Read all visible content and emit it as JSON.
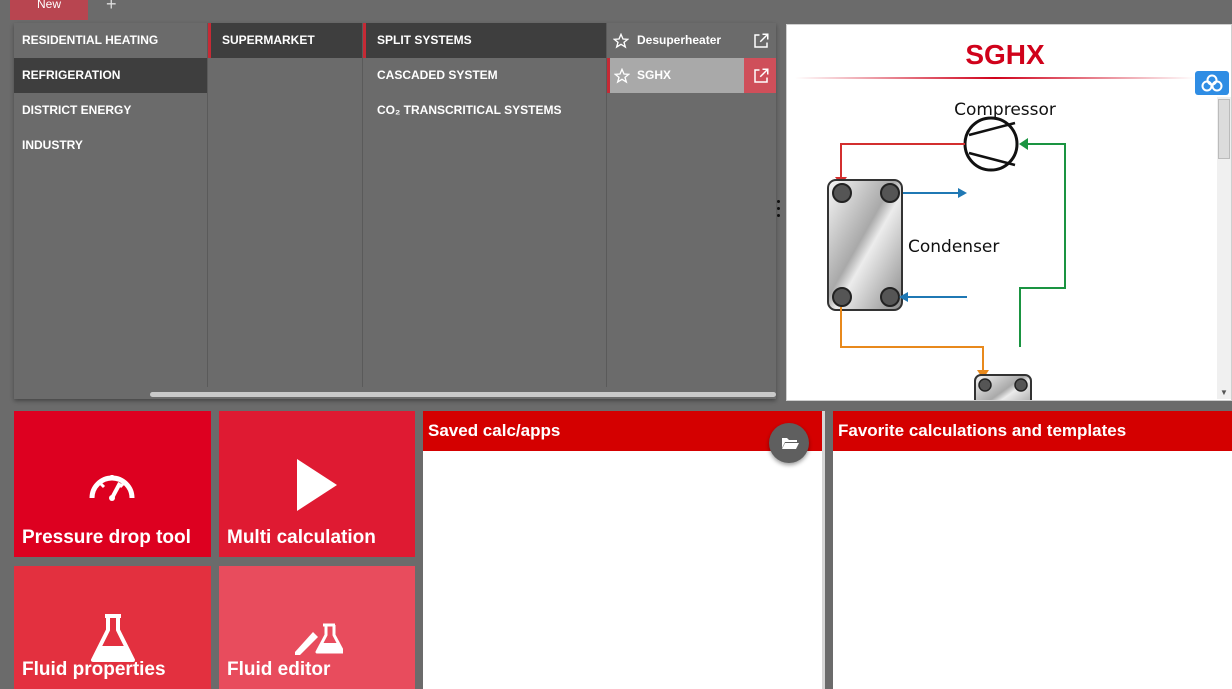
{
  "tabbar": {
    "new_tab_label": "New",
    "add_tab_label": "+"
  },
  "nav": {
    "column1": [
      {
        "label": "RESIDENTIAL HEATING",
        "selected": false
      },
      {
        "label": "REFRIGERATION",
        "selected": true
      },
      {
        "label": "DISTRICT ENERGY",
        "selected": false
      },
      {
        "label": "INDUSTRY",
        "selected": false
      }
    ],
    "column2": [
      {
        "label": "SUPERMARKET",
        "selected": true
      }
    ],
    "column3": [
      {
        "label": "SPLIT SYSTEMS",
        "selected": true
      },
      {
        "label": "CASCADED SYSTEM",
        "selected": false
      },
      {
        "label": "CO₂ TRANSCRITICAL SYSTEMS",
        "selected": false
      }
    ],
    "column4": [
      {
        "label": "Desuperheater",
        "icon": "star-icon",
        "action_icon": "external-link-icon"
      },
      {
        "label": "SGHX",
        "icon": "star-icon",
        "action_icon": "external-link-icon"
      }
    ]
  },
  "preview": {
    "title": "SGHX",
    "diagram": {
      "compressor_label": "Compressor",
      "condenser_label": "Condenser"
    },
    "cloud_icon": "cloud-sync-icon"
  },
  "tiles": [
    {
      "label": "Pressure drop tool",
      "icon": "gauge-icon"
    },
    {
      "label": "Multi calculation",
      "icon": "play-icon"
    },
    {
      "label": "Fluid properties",
      "icon": "flask-icon"
    },
    {
      "label": "Fluid editor",
      "icon": "pencil-flask-icon"
    }
  ],
  "panels": {
    "saved": {
      "title": "Saved calc/apps",
      "icon": "folder-open-icon"
    },
    "favorites": {
      "title": "Favorite calculations and templates"
    }
  },
  "colors": {
    "brand_red": "#d40000",
    "title_red": "#d0021b",
    "nav_bg": "#6b6b6b",
    "nav_selected": "#3e3e3e",
    "accent": "#c62a35"
  }
}
